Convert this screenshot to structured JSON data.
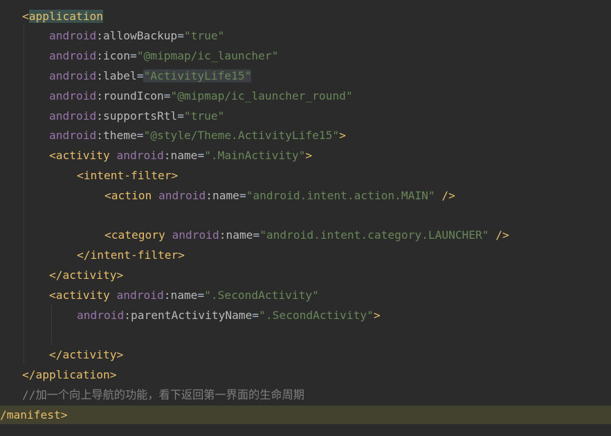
{
  "editor": {
    "lines": [
      {
        "tokens": [
          {
            "t": "tag",
            "v": "<"
          },
          {
            "t": "tag-match",
            "v": "application"
          }
        ]
      },
      {
        "tokens": [
          {
            "t": "ns",
            "v": "android"
          },
          {
            "t": "attr",
            "v": ":allowBackup"
          },
          {
            "t": "plain",
            "v": "="
          },
          {
            "t": "val",
            "v": "\"true\""
          }
        ]
      },
      {
        "tokens": [
          {
            "t": "ns",
            "v": "android"
          },
          {
            "t": "attr",
            "v": ":icon"
          },
          {
            "t": "plain",
            "v": "="
          },
          {
            "t": "val",
            "v": "\"@mipmap/ic_launcher\""
          }
        ]
      },
      {
        "tokens": [
          {
            "t": "ns",
            "v": "android"
          },
          {
            "t": "attr",
            "v": ":label"
          },
          {
            "t": "plain",
            "v": "="
          },
          {
            "t": "val-sel",
            "v": "\"ActivityLife15\""
          }
        ]
      },
      {
        "tokens": [
          {
            "t": "ns",
            "v": "android"
          },
          {
            "t": "attr",
            "v": ":roundIcon"
          },
          {
            "t": "plain",
            "v": "="
          },
          {
            "t": "val",
            "v": "\"@mipmap/ic_launcher_round\""
          }
        ]
      },
      {
        "tokens": [
          {
            "t": "ns",
            "v": "android"
          },
          {
            "t": "attr",
            "v": ":supportsRtl"
          },
          {
            "t": "plain",
            "v": "="
          },
          {
            "t": "val",
            "v": "\"true\""
          }
        ]
      },
      {
        "tokens": [
          {
            "t": "ns",
            "v": "android"
          },
          {
            "t": "attr",
            "v": ":theme"
          },
          {
            "t": "plain",
            "v": "="
          },
          {
            "t": "val",
            "v": "\"@style/Theme.ActivityLife15\""
          },
          {
            "t": "tag",
            "v": ">"
          }
        ]
      },
      {
        "tokens": [
          {
            "t": "tag",
            "v": "<activity "
          },
          {
            "t": "ns",
            "v": "android"
          },
          {
            "t": "attr",
            "v": ":name"
          },
          {
            "t": "plain",
            "v": "="
          },
          {
            "t": "val",
            "v": "\".MainActivity\""
          },
          {
            "t": "tag",
            "v": ">"
          }
        ]
      },
      {
        "tokens": [
          {
            "t": "tag",
            "v": "<intent-filter>"
          }
        ]
      },
      {
        "tokens": [
          {
            "t": "tag",
            "v": "<action "
          },
          {
            "t": "ns",
            "v": "android"
          },
          {
            "t": "attr",
            "v": ":name"
          },
          {
            "t": "plain",
            "v": "="
          },
          {
            "t": "val",
            "v": "\"android.intent.action.MAIN\""
          },
          {
            "t": "tag",
            "v": " />"
          }
        ]
      },
      {
        "tokens": []
      },
      {
        "tokens": [
          {
            "t": "tag",
            "v": "<category "
          },
          {
            "t": "ns",
            "v": "android"
          },
          {
            "t": "attr",
            "v": ":name"
          },
          {
            "t": "plain",
            "v": "="
          },
          {
            "t": "val",
            "v": "\"android.intent.category.LAUNCHER\""
          },
          {
            "t": "tag",
            "v": " />"
          }
        ]
      },
      {
        "tokens": [
          {
            "t": "tag",
            "v": "</intent-filter>"
          }
        ]
      },
      {
        "tokens": [
          {
            "t": "tag",
            "v": "</activity>"
          }
        ]
      },
      {
        "tokens": [
          {
            "t": "tag",
            "v": "<activity "
          },
          {
            "t": "ns",
            "v": "android"
          },
          {
            "t": "attr",
            "v": ":name"
          },
          {
            "t": "plain",
            "v": "="
          },
          {
            "t": "val",
            "v": "\".SecondActivity\""
          }
        ]
      },
      {
        "tokens": [
          {
            "t": "ns",
            "v": "android"
          },
          {
            "t": "attr",
            "v": ":parentActivityName"
          },
          {
            "t": "plain",
            "v": "="
          },
          {
            "t": "val",
            "v": "\".SecondActivity\""
          },
          {
            "t": "tag",
            "v": ">"
          }
        ]
      },
      {
        "tokens": []
      },
      {
        "tokens": [
          {
            "t": "tag",
            "v": "</activity>"
          }
        ]
      },
      {
        "tokens": [
          {
            "t": "tag",
            "v": "</application>"
          }
        ]
      },
      {
        "tokens": [
          {
            "t": "cmt",
            "v": "//加一个向上导航的功能，看下返回第一界面的生命周期"
          }
        ]
      },
      {
        "tokens": [
          {
            "t": "tag",
            "v": "/manifest>"
          }
        ]
      }
    ],
    "colors": {
      "background": "#2b2b2b",
      "tag": "#e8bf6a",
      "namespace": "#9876aa",
      "attribute": "#bababa",
      "value": "#6a8759",
      "comment": "#808080",
      "highlight_line": "#43422f"
    }
  }
}
